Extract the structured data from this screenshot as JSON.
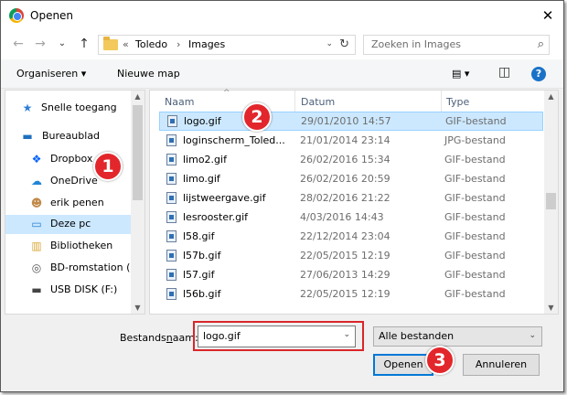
{
  "window": {
    "title": "Openen",
    "close_glyph": "✕"
  },
  "nav": {
    "back_glyph": "←",
    "forward_glyph": "→",
    "recent_glyph": "⌄",
    "up_glyph": "↑",
    "breadcrumb_prefix": "«",
    "breadcrumb": [
      "Toledo",
      "Images"
    ],
    "separator": "›",
    "dropdown_glyph": "⌄",
    "refresh_glyph": "↻"
  },
  "search": {
    "placeholder": "Zoeken in Images",
    "icon_glyph": "⌕"
  },
  "toolbar": {
    "organize_label": "Organiseren",
    "organize_caret": "▾",
    "new_folder_label": "Nieuwe map",
    "view_glyph": "▤",
    "view_caret": "▾",
    "pane_glyph": "◫",
    "help_glyph": "?"
  },
  "sidebar": {
    "items": [
      {
        "label": "Snelle toegang",
        "icon": "star-icon",
        "glyph": "★",
        "color": "#2f7fd8"
      },
      {
        "label": "Bureaublad",
        "icon": "desktop-icon",
        "glyph": "▬",
        "color": "#1f6fbf"
      },
      {
        "label": "Dropbox",
        "icon": "dropbox-icon",
        "glyph": "❖",
        "color": "#0061fe"
      },
      {
        "label": "OneDrive",
        "icon": "cloud-icon",
        "glyph": "☁",
        "color": "#1f84d6"
      },
      {
        "label": "erik penen",
        "icon": "user-icon",
        "glyph": "☻",
        "color": "#c08a4a"
      },
      {
        "label": "Deze pc",
        "icon": "computer-icon",
        "glyph": "▭",
        "color": "#2a7fd0"
      },
      {
        "label": "Bibliotheken",
        "icon": "library-icon",
        "glyph": "▥",
        "color": "#d9a93a"
      },
      {
        "label": "BD-romstation (",
        "icon": "disc-drive-icon",
        "glyph": "◎",
        "color": "#555555"
      },
      {
        "label": "USB DISK (F:)",
        "icon": "usb-drive-icon",
        "glyph": "▬",
        "color": "#444444"
      }
    ],
    "selected_index": 5
  },
  "files": {
    "columns": [
      "Naam",
      "Datum",
      "Type"
    ],
    "sort_glyph": "^",
    "rows": [
      {
        "name": "logo.gif",
        "date": "29/01/2010 14:57",
        "type": "GIF-bestand"
      },
      {
        "name": "loginscherm_Toled...",
        "date": "21/01/2014 23:14",
        "type": "JPG-bestand"
      },
      {
        "name": "limo2.gif",
        "date": "26/02/2016 15:34",
        "type": "GIF-bestand"
      },
      {
        "name": "limo.gif",
        "date": "26/02/2016 20:59",
        "type": "GIF-bestand"
      },
      {
        "name": "lijstweergave.gif",
        "date": "28/02/2016 21:22",
        "type": "GIF-bestand"
      },
      {
        "name": "lesrooster.gif",
        "date": "4/03/2016 14:43",
        "type": "GIF-bestand"
      },
      {
        "name": "l58.gif",
        "date": "22/12/2014 23:04",
        "type": "GIF-bestand"
      },
      {
        "name": "l57b.gif",
        "date": "22/05/2015 12:19",
        "type": "GIF-bestand"
      },
      {
        "name": "l57.gif",
        "date": "27/06/2013 14:29",
        "type": "GIF-bestand"
      },
      {
        "name": "l56b.gif",
        "date": "22/05/2015 12:19",
        "type": "GIF-bestand"
      }
    ],
    "selected_index": 0
  },
  "scroll": {
    "up_glyph": "▲",
    "down_glyph": "▼"
  },
  "footer": {
    "filename_label_a": "Bestands",
    "filename_label_b": "n",
    "filename_label_c": "aam:",
    "filename_value": "logo.gif",
    "filter_value": "Alle bestanden",
    "dropdown_glyph": "⌄",
    "open_label": "Openen",
    "cancel_label": "Annuleren"
  },
  "callouts": [
    "1",
    "2",
    "3"
  ],
  "colors": {
    "selection": "#cce8ff",
    "callout": "#e2262b",
    "accent": "#0078d7"
  }
}
